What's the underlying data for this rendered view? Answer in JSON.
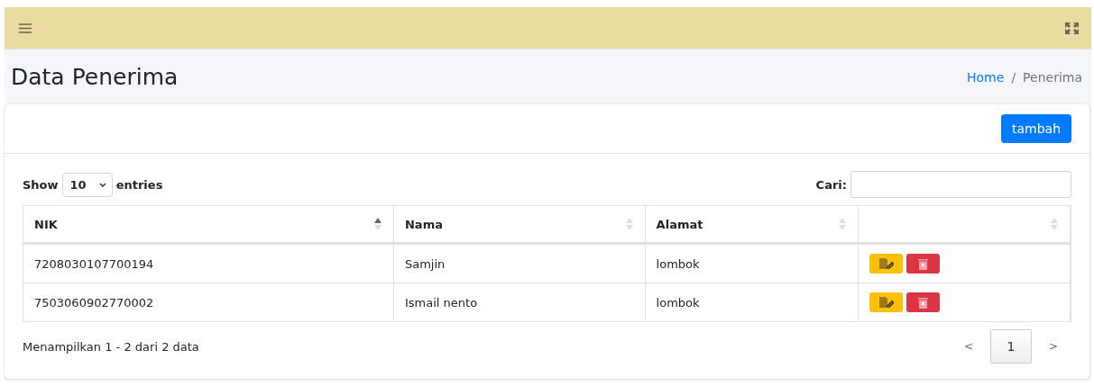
{
  "page_title": "Data Penerima",
  "breadcrumb": [
    {
      "label": "Home",
      "kind": "link"
    },
    {
      "label": "/",
      "kind": "separator"
    },
    {
      "label": "Penerima",
      "kind": "current"
    }
  ],
  "add_button": "tambah",
  "length_menu": {
    "before": "Show",
    "value": "10",
    "after": "entries"
  },
  "search": {
    "label": "Cari:"
  },
  "table": {
    "columns": [
      {
        "label": "NIK",
        "sorted": true
      },
      {
        "label": "Nama",
        "sorted": false
      },
      {
        "label": "Alamat",
        "sorted": false
      },
      {
        "sorted": false
      }
    ],
    "rows": [
      {
        "nik": "7208030107700194",
        "nama": "Samjin",
        "alamat": "lombok"
      },
      {
        "nik": "7503060902770002",
        "nama": "Ismail nento",
        "alamat": "lombok"
      }
    ]
  },
  "info": "Menampilkan 1 - 2 dari 2 data",
  "pagination": [
    {
      "label": "<",
      "kind": "prev",
      "selected": false
    },
    {
      "label": "1",
      "kind": "page",
      "selected": true
    },
    {
      "label": ">",
      "kind": "next",
      "selected": false
    }
  ]
}
